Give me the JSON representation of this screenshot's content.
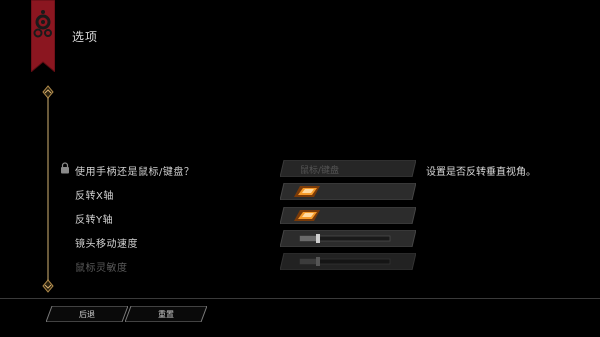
{
  "header": {
    "title": "选项",
    "banner_color": "#8b1620",
    "banner_icon": "gear-cluster-icon"
  },
  "settings": {
    "rows": [
      {
        "label": "使用手柄还是鼠标/键盘？",
        "locked": true,
        "control": "dropdown",
        "value": "鼠标/键盘"
      },
      {
        "label": "反转X轴",
        "locked": false,
        "control": "toggle",
        "checked": true
      },
      {
        "label": "反转Y轴",
        "locked": false,
        "control": "toggle",
        "checked": true
      },
      {
        "label": "镜头移动速度",
        "locked": false,
        "control": "slider",
        "level": 0.2
      },
      {
        "label": "鼠标灵敏度",
        "locked": false,
        "control": "slider",
        "level": 0.2,
        "disabled": true
      }
    ]
  },
  "description": {
    "text": "设置是否反转垂直视角。"
  },
  "footer": {
    "back_label": "后退",
    "reset_label": "重置"
  },
  "colors": {
    "accent": "#f59a2a",
    "panel": "#2a2a2a",
    "text": "#d2d2d2",
    "disabled": "#5a5a5a"
  }
}
